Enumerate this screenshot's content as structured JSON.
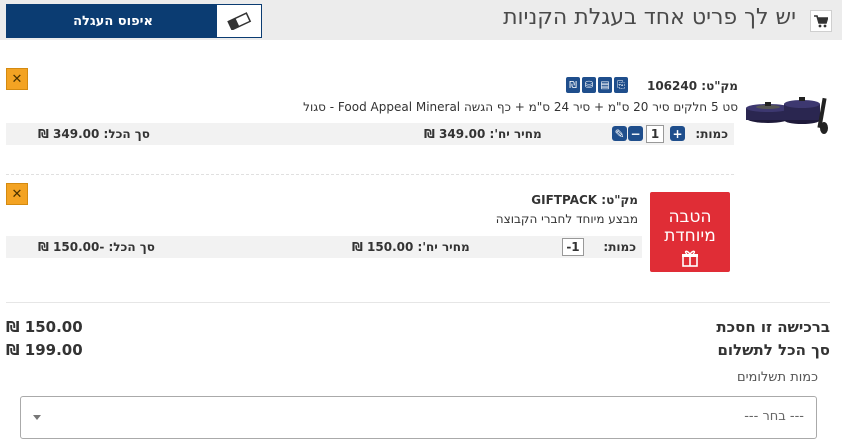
{
  "header": {
    "title": "יש לך פריט אחד בעגלת הקניות",
    "reset_label": "איפוס העגלה",
    "cart_icon": "cart-icon",
    "eraser_icon": "eraser-icon"
  },
  "items": [
    {
      "sku_text": "מק\"ט: 106240",
      "description": "סט 5 חלקים סיר 20 ס\"מ + סיר 24 ס\"מ + כף הגשה Food Appeal Mineral - סגול",
      "qty_label": "כמות:",
      "qty_value": "1",
      "unit_price_text": "מחיר יח': 349.00 ₪",
      "total_text": "סך הכל: 349.00 ₪",
      "sku_icons": [
        "₪",
        "⛁",
        "▤",
        "⎘"
      ]
    },
    {
      "sku_text": "מק\"ט: GIFTPACK",
      "description": "מבצע מיוחד לחברי הקבוצה",
      "qty_label": "כמות:",
      "qty_value": "-1",
      "unit_price_text": "מחיר יח': 150.00 ₪",
      "total_text": "סך הכל: -150.00 ₪",
      "gift_line1": "הטבה",
      "gift_line2": "מיוחדת"
    }
  ],
  "remove_symbol": "✕",
  "summary": {
    "savings_label": "ברכישה זו חסכת",
    "savings_value": "150.00 ₪",
    "total_label": "סך הכל לתשלום",
    "total_value": "199.00 ₪",
    "payments_label": "כמות תשלומים",
    "payments_placeholder": "--- בחר ---"
  },
  "colors": {
    "brand_blue": "#0b3c72",
    "remove_orange": "#f3a323",
    "gift_red": "#e02d36"
  }
}
